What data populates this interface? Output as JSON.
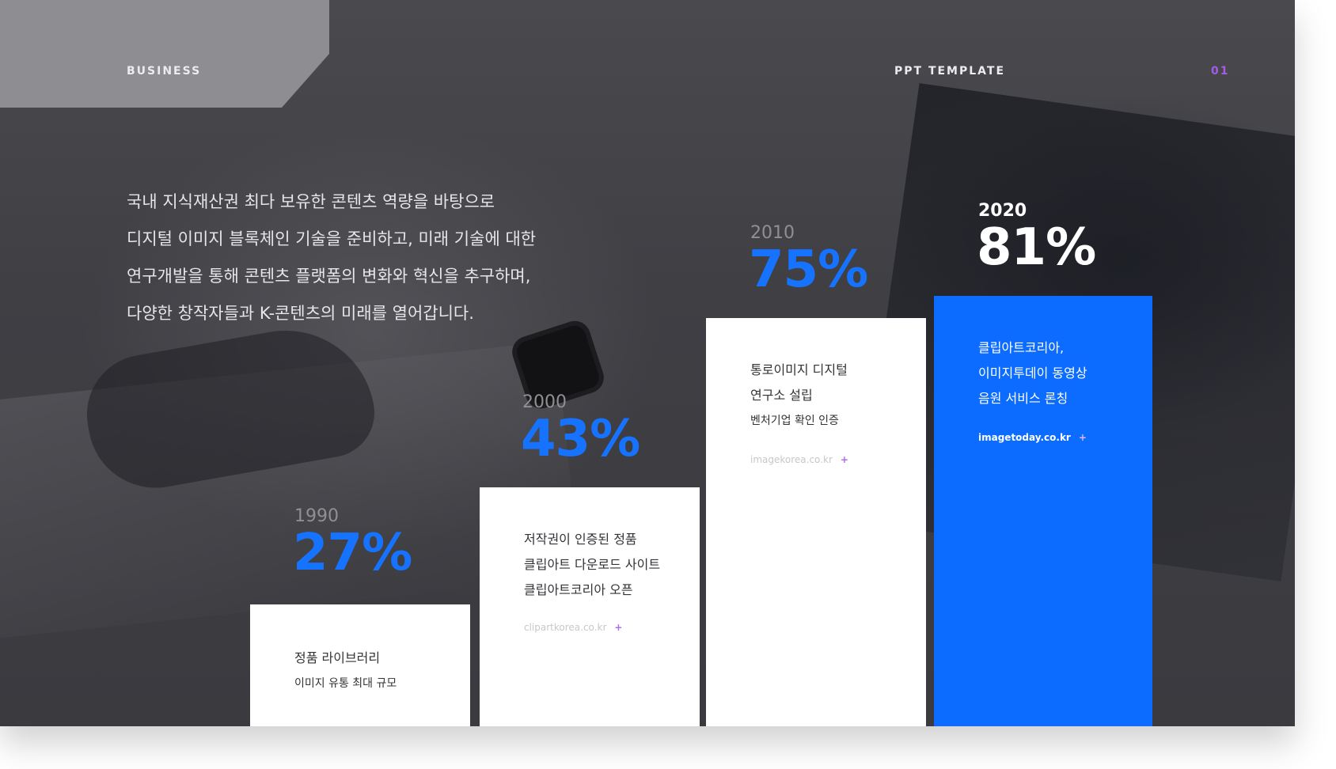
{
  "header": {
    "left_label": "BUSINESS",
    "center_label": "PPT TEMPLATE",
    "page_number": "01"
  },
  "intro": {
    "lines": [
      "국내 지식재산권 최다 보유한 콘텐츠 역량을 바탕으로",
      "디지털 이미지 블록체인 기술을 준비하고, 미래 기술에 대한",
      "연구개발을 통해 콘텐츠 플랫폼의 변화와 혁신을 추구하며,",
      "다양한 창작자들과 K-콘텐츠의 미래를 열어갑니다."
    ]
  },
  "milestones": [
    {
      "year": "1990",
      "percent": "27%",
      "lines": [
        "정품 라이브러리",
        "이미지 유통 최대 규모"
      ],
      "link": ""
    },
    {
      "year": "2000",
      "percent": "43%",
      "lines": [
        "저작권이 인증된 정품",
        "클립아트 다운로드 사이트",
        "클립아트코리아 오픈"
      ],
      "link": "clipartkorea.co.kr"
    },
    {
      "year": "2010",
      "percent": "75%",
      "lines": [
        "통로이미지 디지털",
        "연구소 설립",
        "벤처기업 확인 인증"
      ],
      "link": "imagekorea.co.kr"
    },
    {
      "year": "2020",
      "percent": "81%",
      "lines": [
        "클립아트코리아,",
        "이미지투데이 동영상",
        "음원 서비스 론칭"
      ],
      "link": "imagetoday.co.kr"
    }
  ],
  "colors": {
    "accent_blue": "#1673ff",
    "card_blue": "#0b6cff",
    "plus_purple": "#b06cf0"
  },
  "icons": {
    "link_marker": "plus-icon"
  }
}
